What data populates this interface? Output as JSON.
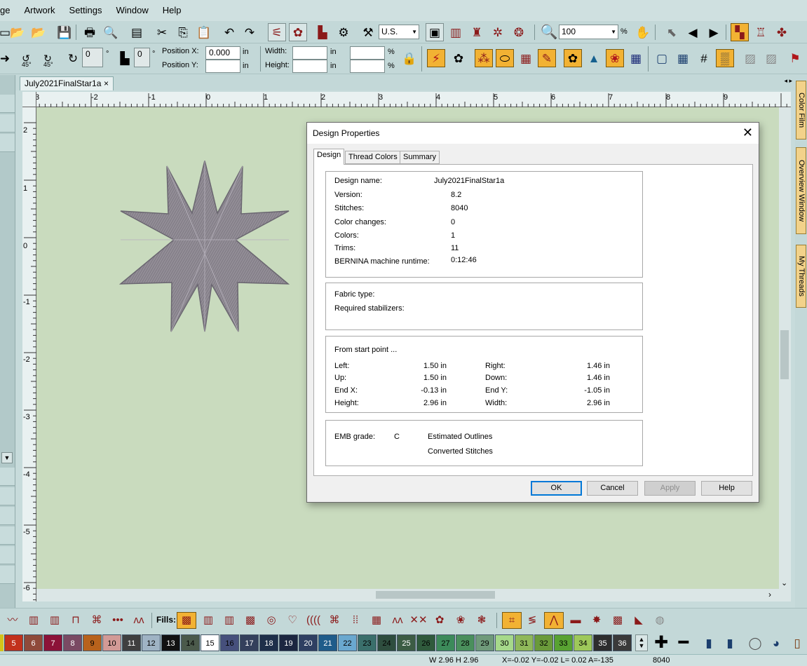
{
  "menu": [
    "ge",
    "Artwork",
    "Settings",
    "Window",
    "Help"
  ],
  "toolbar1": {
    "measure_combo": "U.S.",
    "zoom_value": "100",
    "zoom_unit": "%"
  },
  "toolbar2": {
    "rotate_left_label": "45°",
    "rotate_right_label": "45°",
    "rotate_value": "0",
    "rotate_unit": "°",
    "slant_value": "0",
    "slant_unit": "°",
    "position_x_label": "Position X:",
    "position_x_value": "0.000",
    "position_x_unit": "in",
    "position_y_label": "Position Y:",
    "position_y_value": "",
    "position_y_unit": "in",
    "width_label": "Width:",
    "width_value": "",
    "width_unit": "in",
    "width_pct": "%",
    "height_label": "Height:",
    "height_value": "",
    "height_unit": "in",
    "height_pct": "%"
  },
  "doc_tab": {
    "label": "July2021FinalStar1a",
    "close": "×"
  },
  "ruler": {
    "h_numbers": [
      "3",
      "-2",
      "-1",
      "0",
      "1",
      "2",
      "3",
      "4",
      "5",
      "6",
      "7",
      "8",
      "9"
    ],
    "v_numbers": [
      "2",
      "1",
      "0",
      "-1",
      "-2",
      "-3",
      "-4",
      "-5",
      "-6"
    ]
  },
  "right_dock": [
    "Color Film",
    "Overview Window",
    "My Threads"
  ],
  "dialog": {
    "title": "Design Properties",
    "close": "✕",
    "tabs": [
      "Design",
      "Thread Colors",
      "Summary"
    ],
    "design": [
      {
        "label": "Design name:",
        "value": "July2021FinalStar1a"
      },
      {
        "label": "Version:",
        "value": "8.2"
      },
      {
        "label": "Stitches:",
        "value": "8040"
      },
      {
        "label": "Color changes:",
        "value": "0"
      },
      {
        "label": "Colors:",
        "value": "1"
      },
      {
        "label": "Trims:",
        "value": "11"
      },
      {
        "label": "BERNINA machine runtime:",
        "value": "0:12:46"
      }
    ],
    "fabric_type_label": "Fabric type:",
    "stabilizers_label": "Required stabilizers:",
    "start_point_label": "From start point ...",
    "start_point": [
      {
        "l": "Left:",
        "lv": "1.50 in",
        "r": "Right:",
        "rv": "1.46 in"
      },
      {
        "l": "Up:",
        "lv": "1.50 in",
        "r": "Down:",
        "rv": "1.46 in"
      },
      {
        "l": "End X:",
        "lv": "-0.13 in",
        "r": "End Y:",
        "rv": "-1.05 in"
      },
      {
        "l": "Height:",
        "lv": "2.96 in",
        "r": "Width:",
        "rv": "2.96 in"
      }
    ],
    "emb_grade_label": "EMB grade:",
    "emb_grade_value": "C",
    "estimated_outlines": "Estimated Outlines",
    "converted_stitches": "Converted Stitches",
    "buttons": {
      "ok": "OK",
      "cancel": "Cancel",
      "apply": "Apply",
      "help": "Help"
    }
  },
  "stitchbar": {
    "fills_label": "Fills:"
  },
  "palette": [
    {
      "n": "5",
      "c": "#c2311c",
      "fg": "#ffffff"
    },
    {
      "n": "6",
      "c": "#8f4a3a",
      "fg": "#ffffff"
    },
    {
      "n": "7",
      "c": "#8c1238",
      "fg": "#ffffff"
    },
    {
      "n": "8",
      "c": "#7a4a63",
      "fg": "#ffffff"
    },
    {
      "n": "9",
      "c": "#b8621c",
      "fg": "#000000"
    },
    {
      "n": "10",
      "c": "#d29a96",
      "fg": "#000000"
    },
    {
      "n": "11",
      "c": "#3f3f3f",
      "fg": "#ffffff"
    },
    {
      "n": "12",
      "c": "#9fb3c4",
      "fg": "#000000"
    },
    {
      "n": "13",
      "c": "#111111",
      "fg": "#ffffff"
    },
    {
      "n": "14",
      "c": "#4b5a4b",
      "fg": "#000000"
    },
    {
      "n": "15",
      "c": "#ffffff",
      "fg": "#000000"
    },
    {
      "n": "16",
      "c": "#46507c",
      "fg": "#000000"
    },
    {
      "n": "17",
      "c": "#34405c",
      "fg": "#ffffff"
    },
    {
      "n": "18",
      "c": "#1e2f4a",
      "fg": "#ffffff"
    },
    {
      "n": "19",
      "c": "#1c2640",
      "fg": "#ffffff"
    },
    {
      "n": "20",
      "c": "#2e3f62",
      "fg": "#ffffff"
    },
    {
      "n": "21",
      "c": "#1f5c8a",
      "fg": "#ffffff"
    },
    {
      "n": "22",
      "c": "#6aa8cf",
      "fg": "#000000"
    },
    {
      "n": "23",
      "c": "#3a6f6b",
      "fg": "#000000"
    },
    {
      "n": "24",
      "c": "#2e4d3e",
      "fg": "#000000"
    },
    {
      "n": "25",
      "c": "#3c5c44",
      "fg": "#ffffff"
    },
    {
      "n": "26",
      "c": "#2f5a3c",
      "fg": "#000000"
    },
    {
      "n": "27",
      "c": "#3c8a5a",
      "fg": "#000000"
    },
    {
      "n": "28",
      "c": "#4a8f5c",
      "fg": "#000000"
    },
    {
      "n": "29",
      "c": "#6f9a7a",
      "fg": "#000000"
    },
    {
      "n": "30",
      "c": "#a6d98a",
      "fg": "#000000"
    },
    {
      "n": "31",
      "c": "#8fb85a",
      "fg": "#000000"
    },
    {
      "n": "32",
      "c": "#6a9a3a",
      "fg": "#000000"
    },
    {
      "n": "33",
      "c": "#58a232",
      "fg": "#000000"
    },
    {
      "n": "34",
      "c": "#9ec85a",
      "fg": "#000000"
    },
    {
      "n": "35",
      "c": "#2d2d2d",
      "fg": "#ffffff"
    },
    {
      "n": "36",
      "c": "#3a3a3a",
      "fg": "#ffffff"
    }
  ],
  "status": {
    "size": "W 2.96 H 2.96",
    "coords": "X=-0.02 Y=-0.02 L= 0.02 A=-135",
    "stitches": "8040"
  },
  "colors": {
    "accent_orange": "#f2b233",
    "stitch_red": "#8b1a1a",
    "canvas_green": "#c9dbbe",
    "star_gray": "#8f8a93",
    "ok_border": "#0078d7"
  }
}
